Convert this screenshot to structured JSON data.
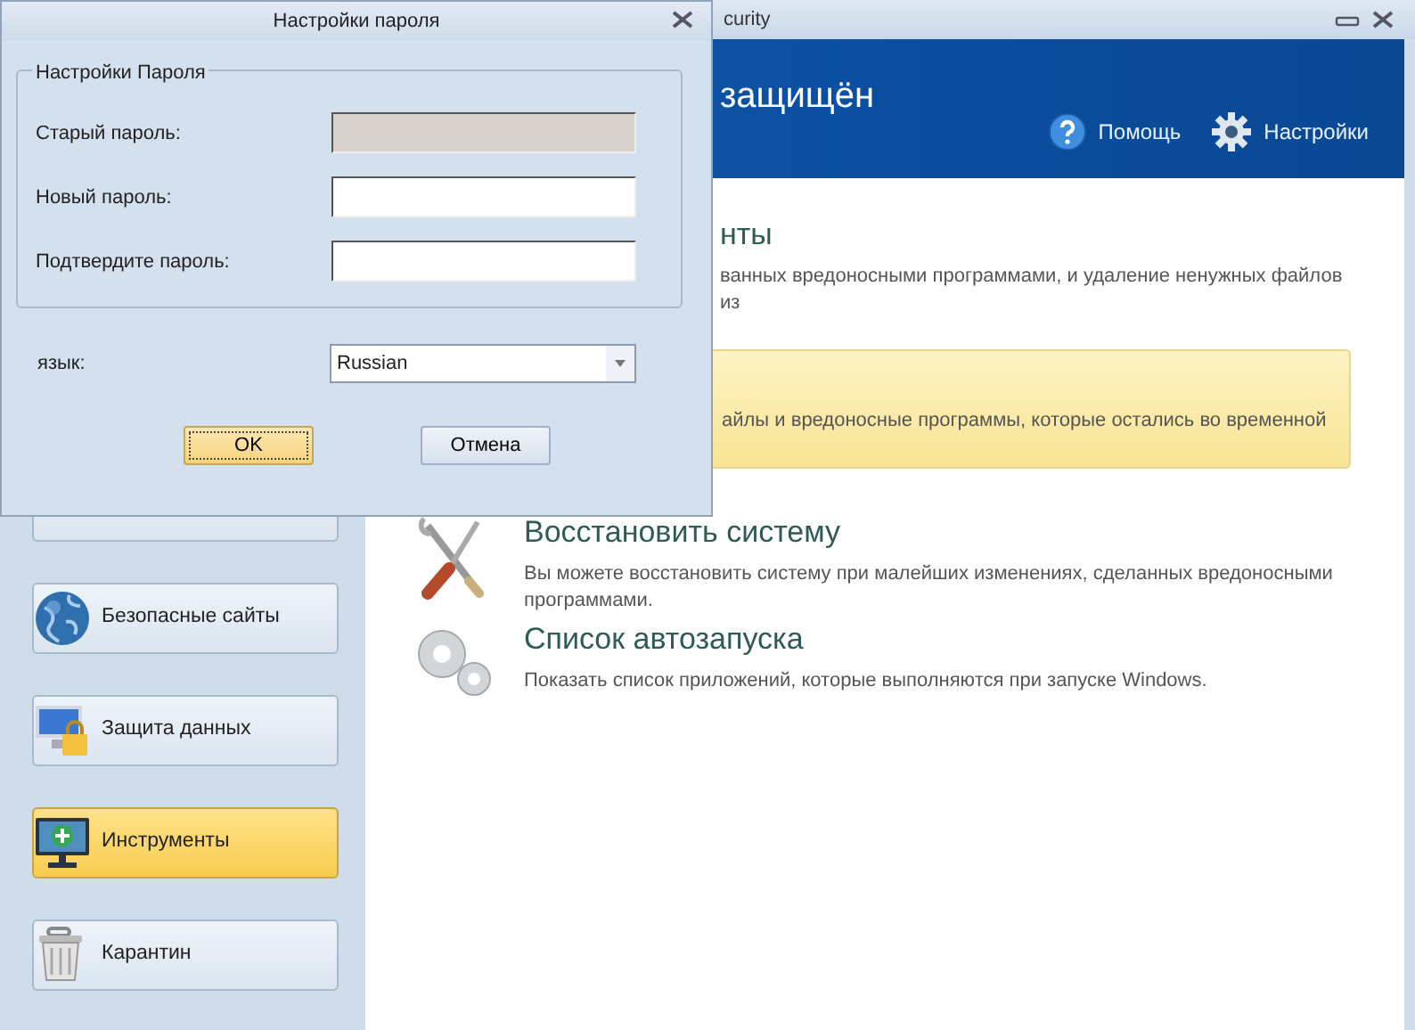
{
  "main_window": {
    "title": "curity",
    "header_title": "защищён",
    "header_links": [
      {
        "label": "Помощь",
        "kind": "help"
      },
      {
        "label": "Настройки",
        "kind": "settings"
      }
    ],
    "sidebar": {
      "items": [
        {
          "selected": false
        },
        {
          "label": "Безопасные сайты",
          "selected": false
        },
        {
          "label": "Защита данных",
          "selected": false
        },
        {
          "label": "Инструменты",
          "selected": true
        },
        {
          "label": "Карантин",
          "selected": false
        }
      ]
    },
    "content_items": [
      {
        "title": "нты",
        "description": "ванных вредоносными программами, и удаление ненужных файлов из",
        "covered": true,
        "highlighted": false
      },
      {
        "description": "айлы и вредоносные программы, которые остались во временной",
        "covered": true,
        "highlighted": true
      },
      {
        "title": "Восстановить систему",
        "description": "Вы можете восстановить систему при малейших изменениях, сделанных вредоносными программами.",
        "covered": false,
        "highlighted": false
      },
      {
        "title": "Список автозапуска",
        "description": "Показать список приложений, которые выполняются при запуске Windows.",
        "covered": false,
        "highlighted": false
      }
    ]
  },
  "dialog": {
    "title": "Настройки пароля",
    "group_title": "Настройки Пароля",
    "fields": [
      {
        "label": "Старый пароль:",
        "disabled": true
      },
      {
        "label": "Новый пароль:",
        "disabled": false
      },
      {
        "label": "Подтвердите пароль:",
        "disabled": false
      }
    ],
    "language": {
      "label": "язык:",
      "value": "Russian"
    },
    "buttons": [
      {
        "label": "OK",
        "focused": true
      },
      {
        "label": "Отмена",
        "focused": false
      }
    ]
  }
}
